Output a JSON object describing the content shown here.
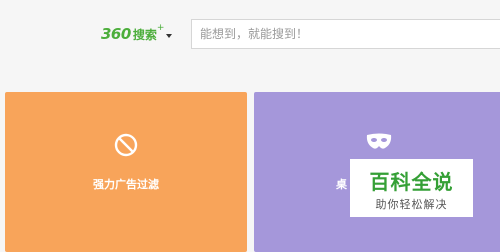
{
  "search": {
    "brand_number": "360",
    "brand_text": "搜索",
    "brand_plus": "+",
    "placeholder": "能想到，就能搜到！"
  },
  "tiles": [
    {
      "label": "强力广告过滤",
      "icon": "block-icon",
      "color": "#f8a45a"
    },
    {
      "label": "桌",
      "icon": "mask-icon",
      "color": "#a597da"
    }
  ],
  "watermark": {
    "title": "百科全说",
    "subtitle": "助你轻松解决"
  }
}
